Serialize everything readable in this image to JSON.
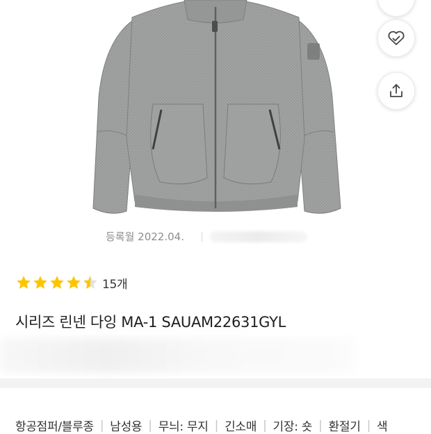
{
  "product": {
    "registered_date": "등록월 2022.04.",
    "rating_value": 4.5,
    "rating_max": 5,
    "review_count": "15개",
    "title": "시리즈 린넨 다잉 MA-1 SAUAM22631GYL"
  },
  "actions": {
    "top_icon": "icon-button",
    "wish_icon": "heart-check-icon",
    "share_icon": "share-icon"
  },
  "tags": [
    "항공점퍼/블루종",
    "남성용",
    "무늬: 무지",
    "긴소매",
    "기장: 숏",
    "환절기",
    "색"
  ],
  "colors": {
    "star": "#ffc400",
    "jacket": "#9b9d9c"
  }
}
